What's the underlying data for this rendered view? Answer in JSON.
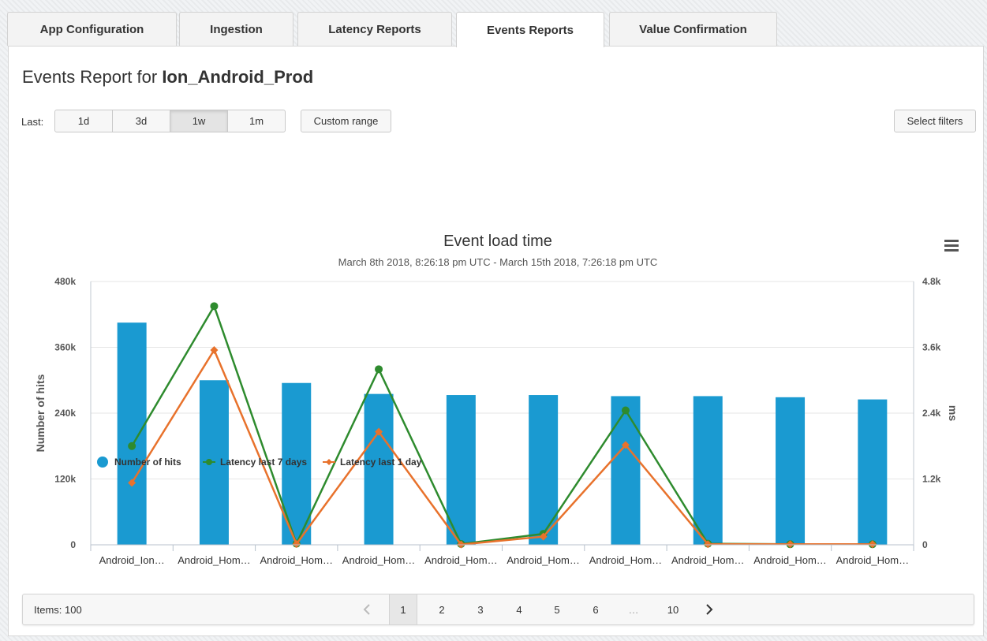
{
  "tabs": [
    {
      "label": "App Configuration"
    },
    {
      "label": "Ingestion"
    },
    {
      "label": "Latency Reports"
    },
    {
      "label": "Events Reports"
    },
    {
      "label": "Value Confirmation"
    }
  ],
  "header": {
    "title_prefix": "Events Report for",
    "app_name": "Ion_Android_Prod"
  },
  "controls": {
    "last_label": "Last:",
    "ranges": [
      "1d",
      "3d",
      "1w",
      "1m"
    ],
    "active_range": "1w",
    "custom_range_label": "Custom range",
    "select_filters_label": "Select filters"
  },
  "chart_data": {
    "type": "bar",
    "title": "Event load time",
    "subtitle": "March 8th 2018, 8:26:18 pm UTC - March 15th 2018, 7:26:18 pm UTC",
    "categories": [
      "Android_Ion…",
      "Android_Hom…",
      "Android_Hom…",
      "Android_Hom…",
      "Android_Hom…",
      "Android_Hom…",
      "Android_Hom…",
      "Android_Hom…",
      "Android_Hom…",
      "Android_Hom…"
    ],
    "ylabel": "Number of hits",
    "y2label": "ms",
    "ylim": [
      0,
      480000
    ],
    "y2lim": [
      0,
      4800
    ],
    "yticks": [
      "0",
      "120k",
      "240k",
      "360k",
      "480k"
    ],
    "y2ticks": [
      "0",
      "1.2k",
      "2.4k",
      "3.6k",
      "4.8k"
    ],
    "grid": true,
    "legend_position": "bottom-left",
    "series": [
      {
        "name": "Number of hits",
        "type": "bar",
        "axis": "left",
        "color": "#1a9ad1",
        "values": [
          405000,
          300000,
          295000,
          275000,
          273000,
          273000,
          271000,
          271000,
          269000,
          265000
        ]
      },
      {
        "name": "Latency last 7 days",
        "type": "line",
        "axis": "right",
        "color": "#2e8b2e",
        "marker": "circle",
        "values": [
          1800,
          4350,
          20,
          3200,
          15,
          200,
          2450,
          20,
          10,
          10
        ]
      },
      {
        "name": "Latency last 1 day",
        "type": "line",
        "axis": "right",
        "color": "#e8722c",
        "marker": "diamond",
        "values": [
          1130,
          3550,
          15,
          2060,
          5,
          150,
          1820,
          10,
          10,
          10
        ]
      }
    ]
  },
  "pagination": {
    "items_label": "Items: 100",
    "prev_icon": "chevron-left-icon",
    "next_icon": "chevron-right-icon",
    "pages": [
      "1",
      "2",
      "3",
      "4",
      "5",
      "6",
      "…",
      "10"
    ],
    "current_page": "1"
  }
}
